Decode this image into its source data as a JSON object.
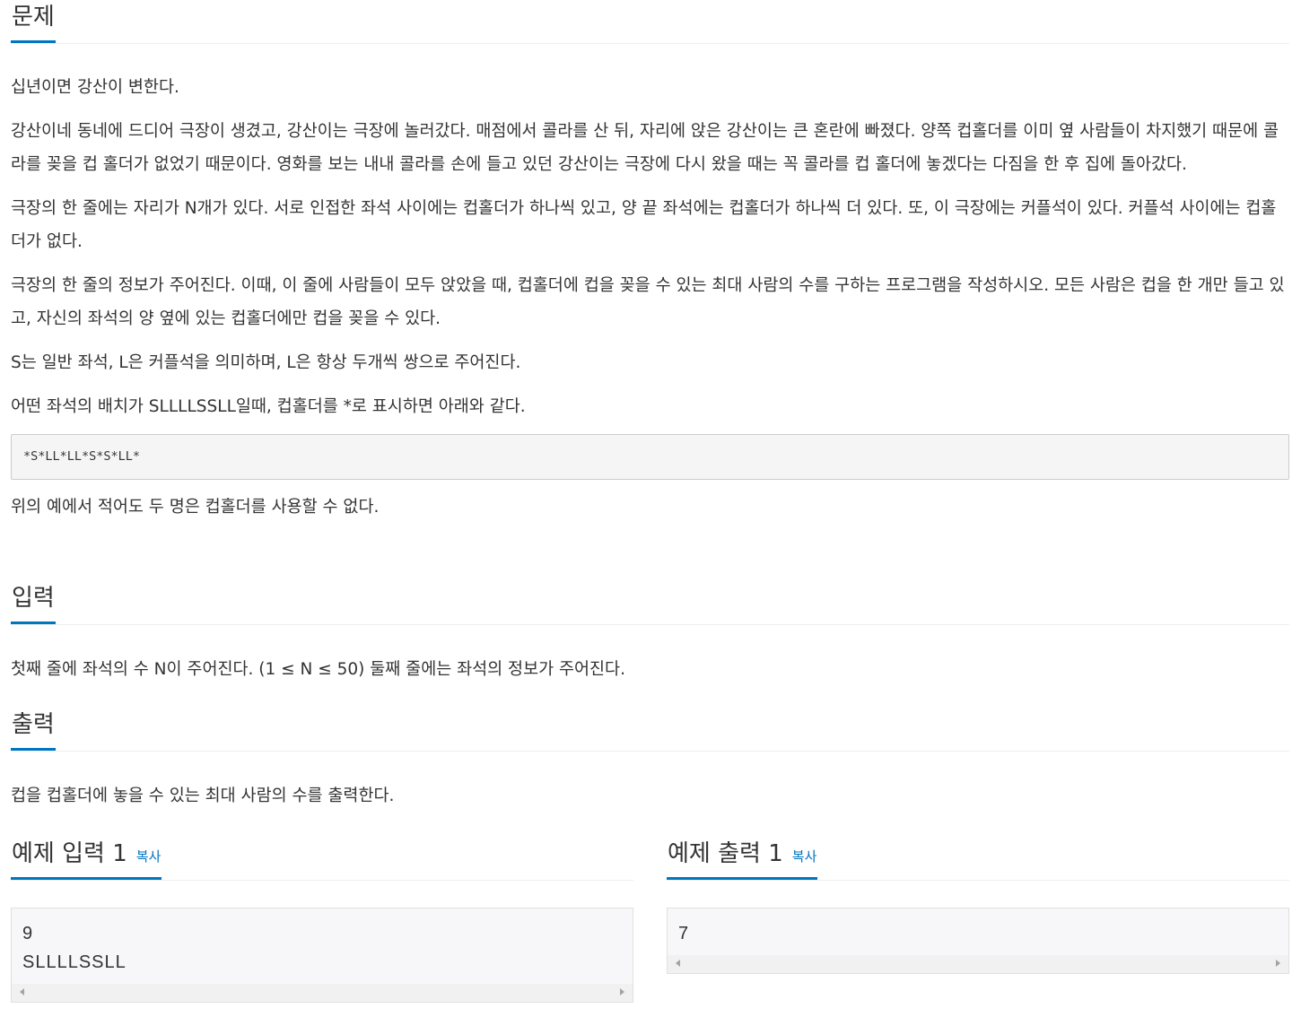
{
  "problem": {
    "heading": "문제",
    "paragraphs": [
      "십년이면 강산이 변한다.",
      "강산이네 동네에 드디어 극장이 생겼고, 강산이는 극장에 놀러갔다. 매점에서 콜라를 산 뒤, 자리에 앉은 강산이는 큰 혼란에 빠졌다. 양쪽 컵홀더를 이미 옆 사람들이 차지했기 때문에 콜라를 꽂을 컵 홀더가 없었기 때문이다. 영화를 보는 내내 콜라를 손에 들고 있던 강산이는 극장에 다시 왔을 때는 꼭 콜라를 컵 홀더에 놓겠다는 다짐을 한 후 집에 돌아갔다.",
      "극장의 한 줄에는 자리가 N개가 있다. 서로 인접한 좌석 사이에는 컵홀더가 하나씩 있고, 양 끝 좌석에는 컵홀더가 하나씩 더 있다. 또, 이 극장에는 커플석이 있다. 커플석 사이에는 컵홀더가 없다.",
      "극장의 한 줄의 정보가 주어진다. 이때, 이 줄에 사람들이 모두 앉았을 때, 컵홀더에 컵을 꽂을 수 있는 최대 사람의 수를 구하는 프로그램을 작성하시오. 모든 사람은 컵을 한 개만 들고 있고, 자신의 좌석의 양 옆에 있는 컵홀더에만 컵을 꽂을 수 있다.",
      "S는 일반 좌석, L은 커플석을 의미하며, L은 항상 두개씩 쌍으로 주어진다.",
      "어떤 좌석의 배치가 SLLLLSSLL일때, 컵홀더를 *로 표시하면 아래와 같다."
    ],
    "code": "*S*LL*LL*S*S*LL*",
    "after_code": "위의 예에서 적어도 두 명은 컵홀더를 사용할 수 없다."
  },
  "input": {
    "heading": "입력",
    "text": "첫째 줄에 좌석의 수 N이 주어진다. (1 ≤ N ≤ 50) 둘째 줄에는 좌석의 정보가 주어진다."
  },
  "output": {
    "heading": "출력",
    "text": "컵을 컵홀더에 놓을 수 있는 최대 사람의 수를 출력한다."
  },
  "sample_input": {
    "heading": "예제 입력 1",
    "copy_label": "복사",
    "content": "9\nSLLLLSSLL"
  },
  "sample_output": {
    "heading": "예제 출력 1",
    "copy_label": "복사",
    "content": "7"
  }
}
